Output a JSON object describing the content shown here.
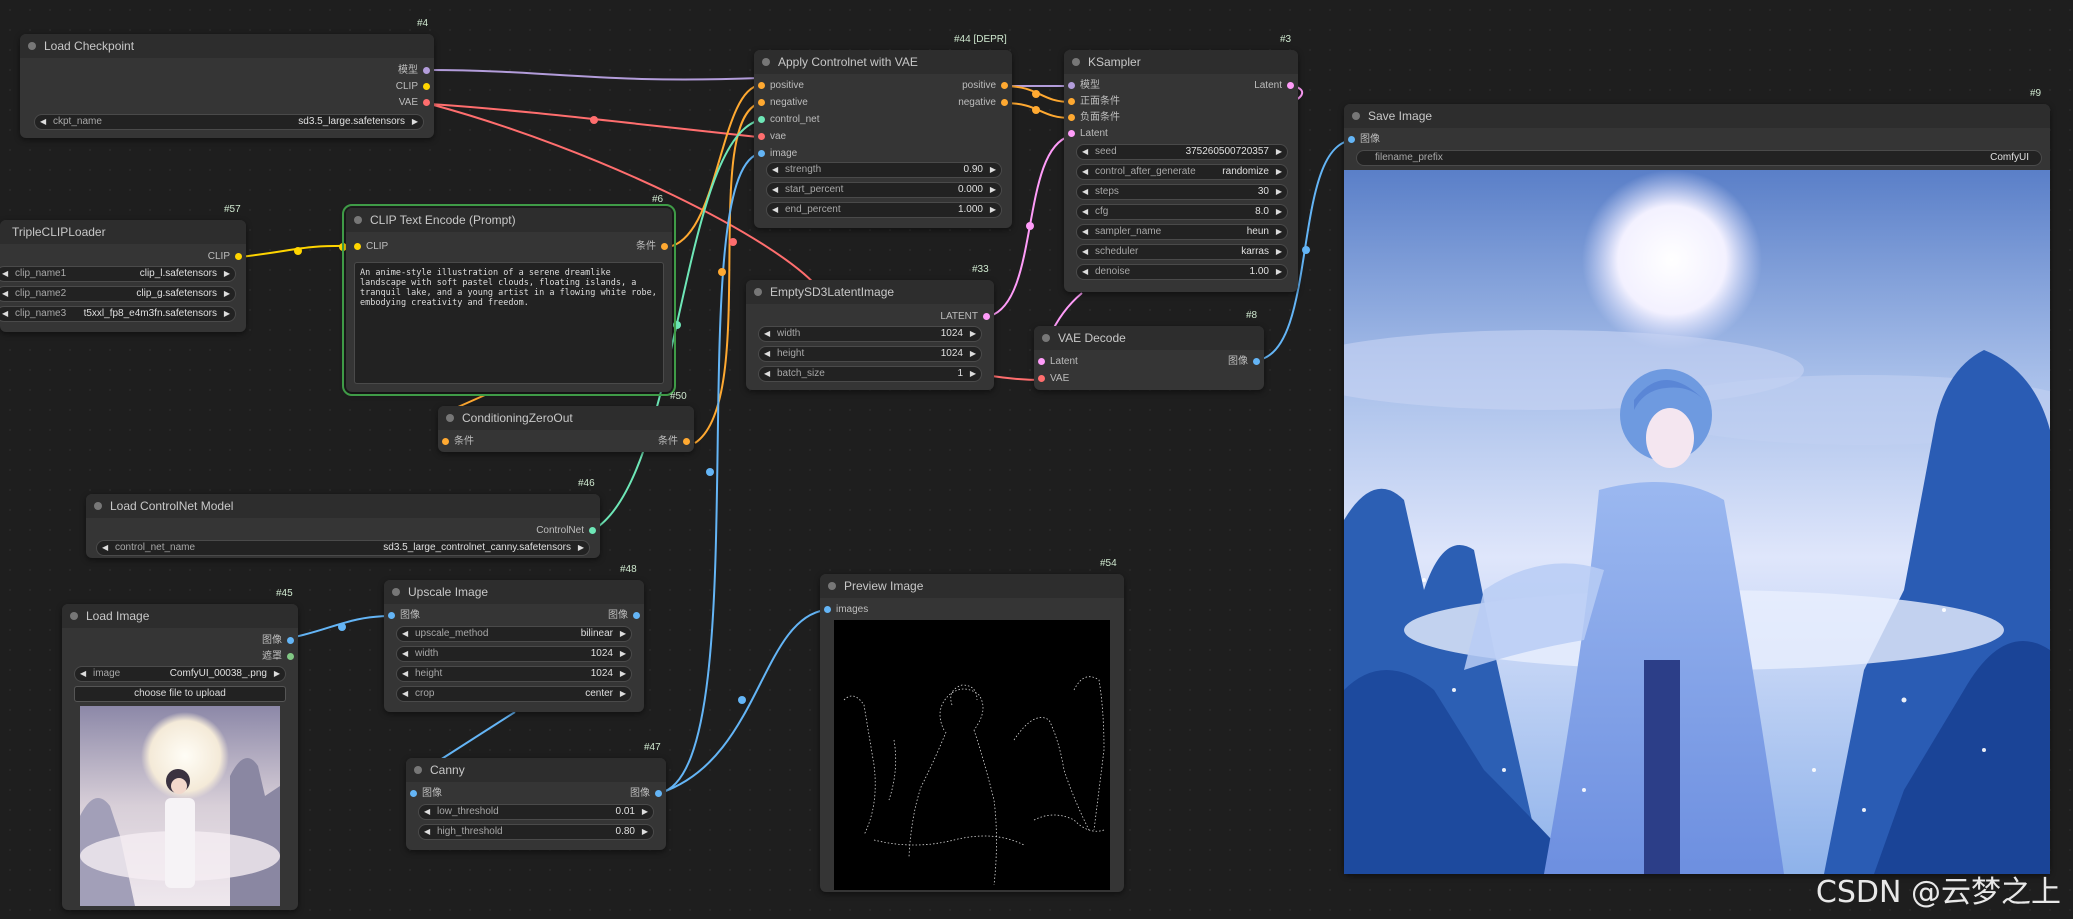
{
  "watermark": "CSDN @云梦之上",
  "colors": {
    "model": "#b39ddb",
    "clip": "#ffd500",
    "vae": "#ff6e6e",
    "conditioning": "#ffa931",
    "control_net": "#6ee7b7",
    "image": "#64b5f6",
    "latent": "#ff9cf9",
    "mask": "#81c784"
  },
  "nodes": {
    "load_checkpoint": {
      "id": "#4",
      "title": "Load Checkpoint",
      "outputs": [
        "模型",
        "CLIP",
        "VAE"
      ],
      "widgets": [
        {
          "label": "ckpt_name",
          "value": "sd3.5_large.safetensors"
        }
      ]
    },
    "triple_clip": {
      "id": "#57",
      "title": "TripleCLIPLoader",
      "outputs": [
        "CLIP"
      ],
      "widgets": [
        {
          "label": "clip_name1",
          "value": "clip_l.safetensors"
        },
        {
          "label": "clip_name2",
          "value": "clip_g.safetensors"
        },
        {
          "label": "clip_name3",
          "value": "t5xxl_fp8_e4m3fn.safetensors"
        }
      ]
    },
    "clip_text": {
      "id": "#6",
      "title": "CLIP Text Encode (Prompt)",
      "inputs": [
        "CLIP"
      ],
      "outputs": [
        "条件"
      ],
      "text": "An anime-style illustration of a serene dreamlike landscape with soft pastel clouds, floating islands, a tranquil lake, and a young artist in a flowing white robe, embodying creativity and freedom."
    },
    "cond_zero": {
      "id": "#50",
      "title": "ConditioningZeroOut",
      "inputs": [
        "条件"
      ],
      "outputs": [
        "条件"
      ]
    },
    "load_controlnet": {
      "id": "#46",
      "title": "Load ControlNet Model",
      "outputs": [
        "ControlNet"
      ],
      "widgets": [
        {
          "label": "control_net_name",
          "value": "sd3.5_large_controlnet_canny.safetensors"
        }
      ]
    },
    "load_image": {
      "id": "#45",
      "title": "Load Image",
      "outputs": [
        "图像",
        "遮罩"
      ],
      "widgets": [
        {
          "label": "image",
          "value": "ComfyUI_00038_.png"
        }
      ],
      "button": "choose file to upload"
    },
    "upscale": {
      "id": "#48",
      "title": "Upscale Image",
      "inputs": [
        "图像"
      ],
      "outputs": [
        "图像"
      ],
      "widgets": [
        {
          "label": "upscale_method",
          "value": "bilinear"
        },
        {
          "label": "width",
          "value": "1024"
        },
        {
          "label": "height",
          "value": "1024"
        },
        {
          "label": "crop",
          "value": "center"
        }
      ]
    },
    "canny": {
      "id": "#47",
      "title": "Canny",
      "inputs": [
        "图像"
      ],
      "outputs": [
        "图像"
      ],
      "widgets": [
        {
          "label": "low_threshold",
          "value": "0.01"
        },
        {
          "label": "high_threshold",
          "value": "0.80"
        }
      ]
    },
    "apply_controlnet": {
      "id": "#44 [DEPR]",
      "title": "Apply Controlnet with VAE",
      "inputs": [
        "positive",
        "negative",
        "control_net",
        "vae",
        "image"
      ],
      "outputs": [
        "positive",
        "negative"
      ],
      "widgets": [
        {
          "label": "strength",
          "value": "0.90"
        },
        {
          "label": "start_percent",
          "value": "0.000"
        },
        {
          "label": "end_percent",
          "value": "1.000"
        }
      ]
    },
    "empty_latent": {
      "id": "#33",
      "title": "EmptySD3LatentImage",
      "outputs": [
        "LATENT"
      ],
      "widgets": [
        {
          "label": "width",
          "value": "1024"
        },
        {
          "label": "height",
          "value": "1024"
        },
        {
          "label": "batch_size",
          "value": "1"
        }
      ]
    },
    "preview": {
      "id": "#54",
      "title": "Preview Image",
      "inputs": [
        "images"
      ]
    },
    "ksampler": {
      "id": "#3",
      "title": "KSampler",
      "inputs": [
        "模型",
        "正面条件",
        "负面条件",
        "Latent"
      ],
      "outputs": [
        "Latent"
      ],
      "widgets": [
        {
          "label": "seed",
          "value": "375260500720357"
        },
        {
          "label": "control_after_generate",
          "value": "randomize"
        },
        {
          "label": "steps",
          "value": "30"
        },
        {
          "label": "cfg",
          "value": "8.0"
        },
        {
          "label": "sampler_name",
          "value": "heun"
        },
        {
          "label": "scheduler",
          "value": "karras"
        },
        {
          "label": "denoise",
          "value": "1.00"
        }
      ]
    },
    "vae_decode": {
      "id": "#8",
      "title": "VAE Decode",
      "inputs": [
        "Latent",
        "VAE"
      ],
      "outputs": [
        "图像"
      ]
    },
    "save_image": {
      "id": "#9",
      "title": "Save Image",
      "inputs": [
        "图像"
      ],
      "widgets": [
        {
          "label": "filename_prefix",
          "value": "ComfyUI"
        }
      ]
    }
  }
}
